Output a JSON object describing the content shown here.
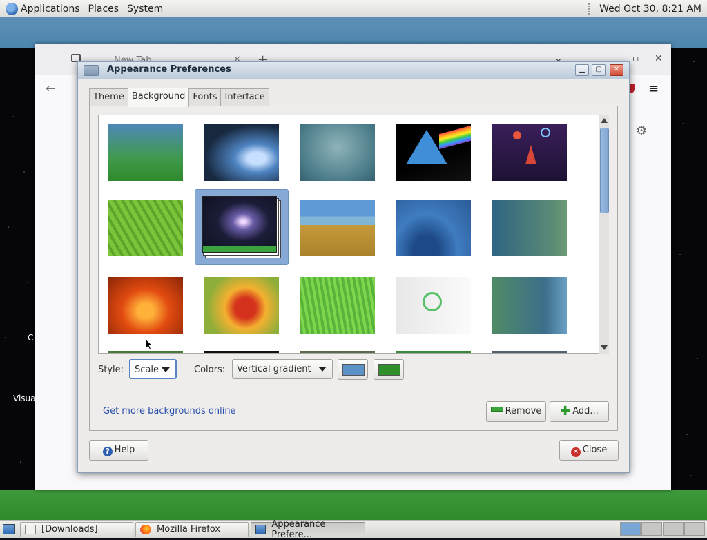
{
  "top_panel": {
    "menus": [
      "Applications",
      "Places",
      "System"
    ],
    "clock": "Wed Oct 30,  8:21 AM"
  },
  "desktop": {
    "icon_labels": [
      "C",
      "Visua"
    ]
  },
  "firefox": {
    "tab_title": "New Tab"
  },
  "dialog": {
    "title": "Appearance Preferences",
    "tabs": [
      "Theme",
      "Background",
      "Fonts",
      "Interface"
    ],
    "active_tab": "Background",
    "wallpapers": [
      {
        "name": "blue-green-gradient",
        "selected": false
      },
      {
        "name": "water-drop",
        "selected": false
      },
      {
        "name": "teal-haze",
        "selected": false
      },
      {
        "name": "arch-prism",
        "selected": false
      },
      {
        "name": "space-rocket",
        "selected": false
      },
      {
        "name": "green-leaf",
        "selected": false
      },
      {
        "name": "comet",
        "selected": true
      },
      {
        "name": "sea-grass",
        "selected": false
      },
      {
        "name": "blue-waves",
        "selected": false
      },
      {
        "name": "teal-green-dots",
        "selected": false
      },
      {
        "name": "orange-flower",
        "selected": false
      },
      {
        "name": "red-marigold",
        "selected": false
      },
      {
        "name": "grass-blades",
        "selected": false
      },
      {
        "name": "white-swirl-logo",
        "selected": false
      },
      {
        "name": "green-blue-flow",
        "selected": false
      }
    ],
    "style_label": "Style:",
    "style_value": "Scale",
    "colors_label": "Colors:",
    "colors_value": "Vertical gradient",
    "primary_color": "#5b93c9",
    "secondary_color": "#2f8f2a",
    "more_link": "Get more backgrounds online",
    "remove_label": "Remove",
    "add_label": "Add...",
    "help_label": "Help",
    "close_label": "Close"
  },
  "taskbar": {
    "tasks": [
      "[Downloads]",
      "Mozilla Firefox",
      "Appearance Prefere..."
    ],
    "active_task": "Appearance Prefere..."
  }
}
